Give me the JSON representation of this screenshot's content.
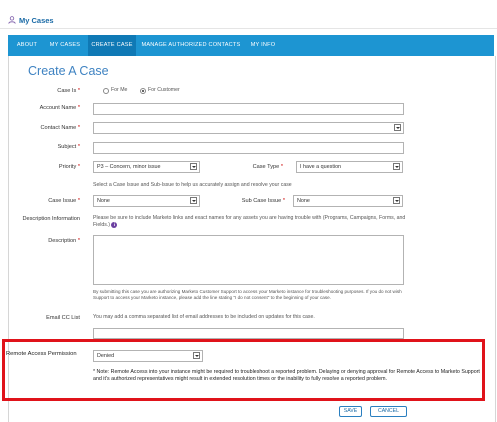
{
  "header": {
    "title": "My Cases",
    "icon": "user-icon"
  },
  "nav": {
    "tabs": [
      {
        "label": "ABOUT",
        "active": false
      },
      {
        "label": "MY CASES",
        "active": false
      },
      {
        "label": "CREATE CASE",
        "active": true
      },
      {
        "label": "MANAGE AUTHORIZED CONTACTS",
        "active": false
      },
      {
        "label": "MY INFO",
        "active": false
      }
    ],
    "bg_color": "#1d95d2"
  },
  "form": {
    "title": "Create A Case",
    "case_is": {
      "label": "Case Is",
      "options": [
        "For Me",
        "For Customer"
      ],
      "selected": "For Customer"
    },
    "account_name": {
      "label": "Account Name",
      "value": ""
    },
    "contact_name": {
      "label": "Contact Name",
      "value": ""
    },
    "subject": {
      "label": "Subject",
      "value": ""
    },
    "priority": {
      "label": "Priority",
      "value": "P3 – Concern, minor issue"
    },
    "case_type": {
      "label": "Case Type",
      "value": "I have a question"
    },
    "issue_help": "Select a Case Issue and Sub-Issue to help us accurately assign and resolve your case",
    "case_issue": {
      "label": "Case Issue",
      "value": "None"
    },
    "sub_case_issue": {
      "label": "Sub Case Issue",
      "value": "None"
    },
    "description_info": {
      "label": "Description Information",
      "text": "Please be sure to include Marketo links and exact names for any assets you are having trouble with (Programs, Campaigns, Forms, and Fields.)"
    },
    "description": {
      "label": "Description",
      "value": ""
    },
    "consent_text": "By submitting this case you are authorizing Marketo Customer Support to access your Marketo instance for troubleshooting purposes. If you do not wish Support to access your Marketo instance, please add the line stating \"I do not consent\" to the beginning of your case.",
    "email_cc": {
      "label": "Email CC List",
      "help": "You may add a comma separated list of email addresses to be included on updates for this case.",
      "value": ""
    },
    "remote_access": {
      "label": "Remote Access Permission",
      "value": "Denied",
      "note": "* Note: Remote Access into your instance might be required to troubleshoot a reported problem. Delaying or denying approval for Remote Access to Marketo Support and it's authorized representatives might result in extended resolution times or the inability to fully resolve a reported problem."
    },
    "save_label": "SAVE",
    "cancel_label": "CANCEL",
    "highlight_color": "#e0131a"
  }
}
